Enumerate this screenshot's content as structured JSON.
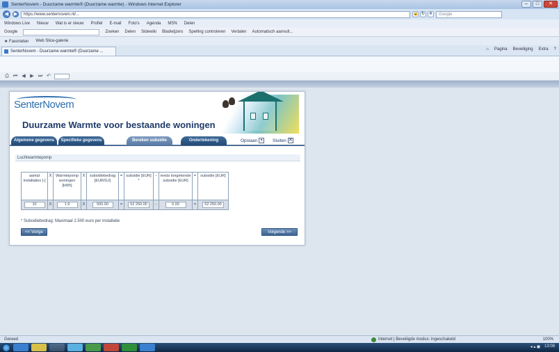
{
  "browser": {
    "window_title": "SenterNovem - Duurzame warmte® (Duurzame warmte) - Windows Internet Explorer",
    "url": "https://www.senternovem.nl/...",
    "search_placeholder": "Google",
    "linkbar": [
      "Windows Live",
      "Nieuw",
      "Wat is er nieuw",
      "Profiel",
      "E-mail",
      "Foto's",
      "Agenda",
      "MSN",
      "Delen"
    ],
    "googlebar": [
      "Google",
      "Zoeken",
      "Delen",
      "Sidewiki",
      "Bladwijzers",
      "Spelling controleren",
      "Vertalen",
      "Automatisch aanvull..."
    ],
    "favorites_label": "Favorieten",
    "favorites_item": "Web Slice-galerie",
    "tab_title": "SenterNovem - Duurzame warmte® (Duurzame ...",
    "commands": [
      "Pagina",
      "Beveiliging",
      "Extra"
    ],
    "status_left": "Gereed",
    "status_zone": "Internet | Beveiligde modus: ingeschakeld",
    "zoom": "100%",
    "clock": "13:08"
  },
  "page": {
    "brand": "SenterNovem",
    "title": "Duurzame Warmte voor bestaande woningen",
    "tabs": [
      "Algemene gegevens",
      "Specifieke gegevens",
      "Bereken subsidie",
      "Ondertekening"
    ],
    "active_tab": "Bereken subsidie",
    "save_label": "Opslaan",
    "close_label": "Sluiten",
    "section_label": "Luchtwarmtepomp",
    "table": {
      "headers": [
        "aantal installaties [-]",
        "Warmtepomp woningen [kWh]",
        "subsidiebedrag [EUR/GJ]",
        "subsidie [EUR] *",
        "reeds toegekende subsidie [EUR]",
        "subsidie [EUR]"
      ],
      "operators": [
        "X",
        "X",
        "=",
        "-",
        "="
      ],
      "values": [
        "10",
        "1.9",
        "500.00",
        "52 250.00",
        "0.00",
        "52 250.00"
      ]
    },
    "footnote": "* Subsidiebedrag: Maximaal 2.500 euro per installatie",
    "prev_button": "<< Vorige",
    "next_button": "Volgende >>"
  }
}
